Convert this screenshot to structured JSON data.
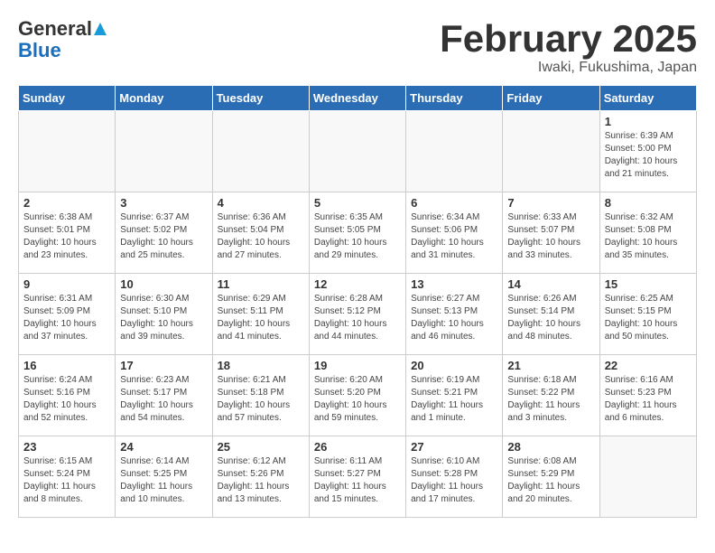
{
  "header": {
    "logo_general": "General",
    "logo_blue": "Blue",
    "title": "February 2025",
    "subtitle": "Iwaki, Fukushima, Japan"
  },
  "days_of_week": [
    "Sunday",
    "Monday",
    "Tuesday",
    "Wednesday",
    "Thursday",
    "Friday",
    "Saturday"
  ],
  "weeks": [
    [
      {
        "day": "",
        "info": ""
      },
      {
        "day": "",
        "info": ""
      },
      {
        "day": "",
        "info": ""
      },
      {
        "day": "",
        "info": ""
      },
      {
        "day": "",
        "info": ""
      },
      {
        "day": "",
        "info": ""
      },
      {
        "day": "1",
        "info": "Sunrise: 6:39 AM\nSunset: 5:00 PM\nDaylight: 10 hours\nand 21 minutes."
      }
    ],
    [
      {
        "day": "2",
        "info": "Sunrise: 6:38 AM\nSunset: 5:01 PM\nDaylight: 10 hours\nand 23 minutes."
      },
      {
        "day": "3",
        "info": "Sunrise: 6:37 AM\nSunset: 5:02 PM\nDaylight: 10 hours\nand 25 minutes."
      },
      {
        "day": "4",
        "info": "Sunrise: 6:36 AM\nSunset: 5:04 PM\nDaylight: 10 hours\nand 27 minutes."
      },
      {
        "day": "5",
        "info": "Sunrise: 6:35 AM\nSunset: 5:05 PM\nDaylight: 10 hours\nand 29 minutes."
      },
      {
        "day": "6",
        "info": "Sunrise: 6:34 AM\nSunset: 5:06 PM\nDaylight: 10 hours\nand 31 minutes."
      },
      {
        "day": "7",
        "info": "Sunrise: 6:33 AM\nSunset: 5:07 PM\nDaylight: 10 hours\nand 33 minutes."
      },
      {
        "day": "8",
        "info": "Sunrise: 6:32 AM\nSunset: 5:08 PM\nDaylight: 10 hours\nand 35 minutes."
      }
    ],
    [
      {
        "day": "9",
        "info": "Sunrise: 6:31 AM\nSunset: 5:09 PM\nDaylight: 10 hours\nand 37 minutes."
      },
      {
        "day": "10",
        "info": "Sunrise: 6:30 AM\nSunset: 5:10 PM\nDaylight: 10 hours\nand 39 minutes."
      },
      {
        "day": "11",
        "info": "Sunrise: 6:29 AM\nSunset: 5:11 PM\nDaylight: 10 hours\nand 41 minutes."
      },
      {
        "day": "12",
        "info": "Sunrise: 6:28 AM\nSunset: 5:12 PM\nDaylight: 10 hours\nand 44 minutes."
      },
      {
        "day": "13",
        "info": "Sunrise: 6:27 AM\nSunset: 5:13 PM\nDaylight: 10 hours\nand 46 minutes."
      },
      {
        "day": "14",
        "info": "Sunrise: 6:26 AM\nSunset: 5:14 PM\nDaylight: 10 hours\nand 48 minutes."
      },
      {
        "day": "15",
        "info": "Sunrise: 6:25 AM\nSunset: 5:15 PM\nDaylight: 10 hours\nand 50 minutes."
      }
    ],
    [
      {
        "day": "16",
        "info": "Sunrise: 6:24 AM\nSunset: 5:16 PM\nDaylight: 10 hours\nand 52 minutes."
      },
      {
        "day": "17",
        "info": "Sunrise: 6:23 AM\nSunset: 5:17 PM\nDaylight: 10 hours\nand 54 minutes."
      },
      {
        "day": "18",
        "info": "Sunrise: 6:21 AM\nSunset: 5:18 PM\nDaylight: 10 hours\nand 57 minutes."
      },
      {
        "day": "19",
        "info": "Sunrise: 6:20 AM\nSunset: 5:20 PM\nDaylight: 10 hours\nand 59 minutes."
      },
      {
        "day": "20",
        "info": "Sunrise: 6:19 AM\nSunset: 5:21 PM\nDaylight: 11 hours\nand 1 minute."
      },
      {
        "day": "21",
        "info": "Sunrise: 6:18 AM\nSunset: 5:22 PM\nDaylight: 11 hours\nand 3 minutes."
      },
      {
        "day": "22",
        "info": "Sunrise: 6:16 AM\nSunset: 5:23 PM\nDaylight: 11 hours\nand 6 minutes."
      }
    ],
    [
      {
        "day": "23",
        "info": "Sunrise: 6:15 AM\nSunset: 5:24 PM\nDaylight: 11 hours\nand 8 minutes."
      },
      {
        "day": "24",
        "info": "Sunrise: 6:14 AM\nSunset: 5:25 PM\nDaylight: 11 hours\nand 10 minutes."
      },
      {
        "day": "25",
        "info": "Sunrise: 6:12 AM\nSunset: 5:26 PM\nDaylight: 11 hours\nand 13 minutes."
      },
      {
        "day": "26",
        "info": "Sunrise: 6:11 AM\nSunset: 5:27 PM\nDaylight: 11 hours\nand 15 minutes."
      },
      {
        "day": "27",
        "info": "Sunrise: 6:10 AM\nSunset: 5:28 PM\nDaylight: 11 hours\nand 17 minutes."
      },
      {
        "day": "28",
        "info": "Sunrise: 6:08 AM\nSunset: 5:29 PM\nDaylight: 11 hours\nand 20 minutes."
      },
      {
        "day": "",
        "info": ""
      }
    ]
  ]
}
